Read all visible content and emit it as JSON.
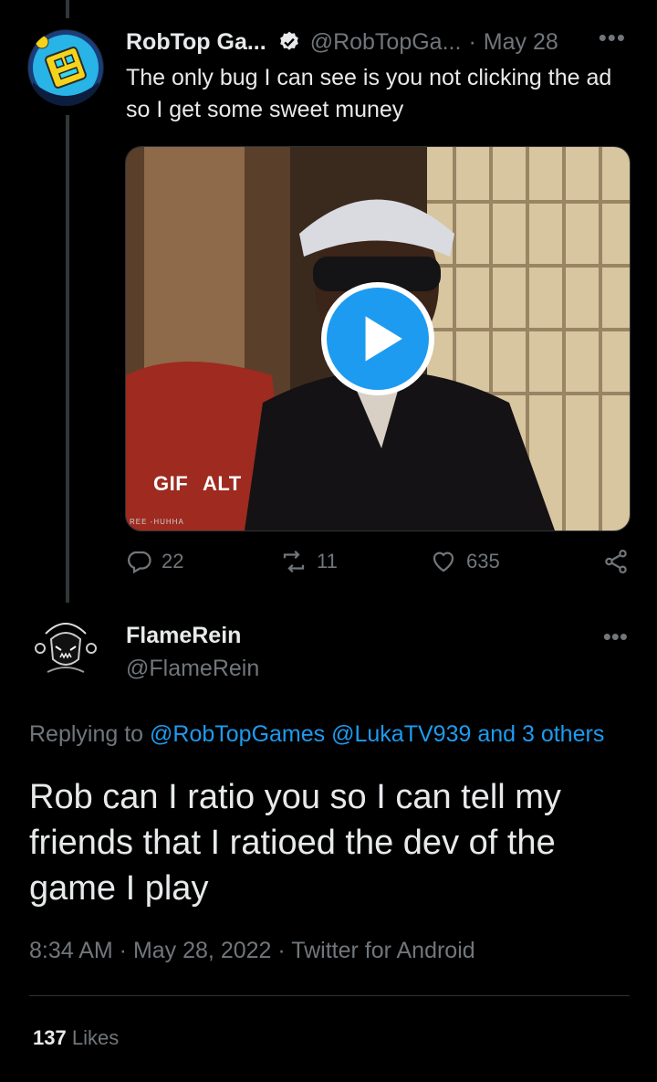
{
  "tweet": {
    "name": "RobTop Ga...",
    "handle": "@RobTopGa...",
    "separator": "·",
    "date": "May 28",
    "more": "•••",
    "text": "The only bug I can see is you not clicking the ad so I get some sweet muney",
    "media": {
      "gif_label": "GIF",
      "alt_label": "ALT",
      "watermark": "REE -HUHHA"
    },
    "replies": "22",
    "retweets": "11",
    "likes": "635"
  },
  "reply": {
    "name": "FlameRein",
    "handle": "@FlameRein",
    "more": "•••",
    "replying_prefix": "Replying to",
    "mention1": "@RobTopGames",
    "mention2": "@LukaTV939",
    "and_others": "and 3 others",
    "text": "Rob can I ratio you so I can tell my friends that I ratioed the dev of the game I play",
    "meta": "8:34 AM · May 28, 2022 · Twitter for Android",
    "likes_count": "137",
    "likes_label": "Likes"
  },
  "colors": {
    "accent": "#1d9bf0",
    "muted": "#71767b",
    "text": "#e7e9ea",
    "background": "#000000"
  }
}
